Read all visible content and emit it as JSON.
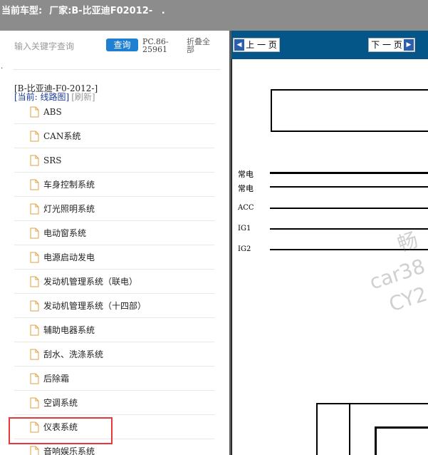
{
  "window": {
    "current_model_label": "当前车型:",
    "manufacturer_label": "厂家:B-比亚迪F02012-",
    "trailing_dot": "."
  },
  "left_panel": {
    "search_placeholder": "输入关键字查询",
    "query_button": "查询",
    "pc_code": "PC.86-25961",
    "collapse_all": "折叠全部",
    "stray_dot": ".",
    "root_title": "[B-比亚迪-F0-2012-]",
    "current_label": "[当前: 线路图]",
    "refresh_label": "[刷新]",
    "tree_items": [
      {
        "label": "ABS"
      },
      {
        "label": "CAN系统"
      },
      {
        "label": "SRS"
      },
      {
        "label": "车身控制系统"
      },
      {
        "label": "灯光照明系统"
      },
      {
        "label": "电动窗系统"
      },
      {
        "label": "电源启动发电"
      },
      {
        "label": "发动机管理系统（联电）"
      },
      {
        "label": "发动机管理系统（十四部）"
      },
      {
        "label": "辅助电器系统"
      },
      {
        "label": "刮水、洗涤系统"
      },
      {
        "label": "后除霜"
      },
      {
        "label": "空调系统"
      },
      {
        "label": "仪表系统"
      },
      {
        "label": "音响娱乐系统"
      }
    ],
    "highlighted_item": "仪表系统"
  },
  "right_panel": {
    "prev_label": "上 一 页",
    "next_label": "下 一 页",
    "diagram_labels": [
      "常电",
      "常电",
      "ACC",
      "IG1",
      "IG2"
    ],
    "watermarks": [
      "畅",
      "car38",
      "CY2"
    ]
  },
  "colors": {
    "topbar": "#8c8c8c",
    "query_button": "#1f7fd1",
    "navbar": "#045689",
    "highlight": "#e8383b"
  }
}
